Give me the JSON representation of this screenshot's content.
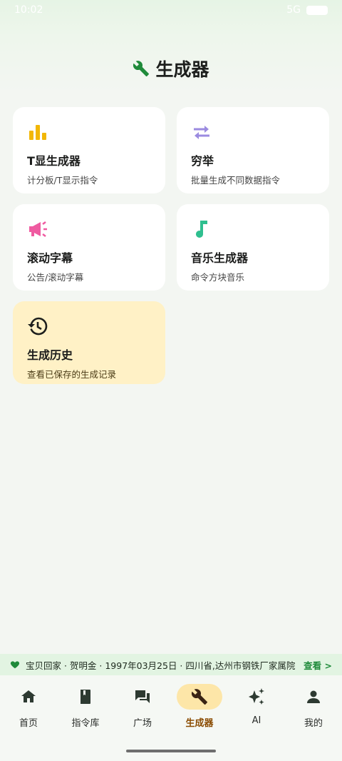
{
  "status": {
    "time": "10:02",
    "signal": "5G"
  },
  "header": {
    "title": "生成器"
  },
  "cards": [
    {
      "title": "T显生成器",
      "subtitle": "计分板/T显示指令",
      "icon": "bar-chart-icon",
      "color": "#f2b705"
    },
    {
      "title": "穷举",
      "subtitle": "批量生成不同数据指令",
      "icon": "swap-arrows-icon",
      "color": "#9b8be0"
    },
    {
      "title": "滚动字幕",
      "subtitle": "公告/滚动字幕",
      "icon": "megaphone-icon",
      "color": "#ef5ba1"
    },
    {
      "title": "音乐生成器",
      "subtitle": "命令方块音乐",
      "icon": "music-note-icon",
      "color": "#2fbf8f"
    },
    {
      "title": "生成历史",
      "subtitle": "查看已保存的生成记录",
      "icon": "history-icon",
      "color": "#1d1f1d"
    }
  ],
  "ticker": {
    "message": "宝贝回家 · 贺明金 · 1997年03月25日 · 四川省,达州市钢铁厂家属院",
    "action": "查看 >"
  },
  "nav": {
    "items": [
      {
        "label": "首页",
        "icon": "home-icon"
      },
      {
        "label": "指令库",
        "icon": "book-icon"
      },
      {
        "label": "广场",
        "icon": "forum-icon"
      },
      {
        "label": "生成器",
        "icon": "wrench-icon",
        "active": true
      },
      {
        "label": "AI",
        "icon": "sparkle-icon"
      },
      {
        "label": "我的",
        "icon": "person-icon"
      }
    ]
  },
  "colors": {
    "accent": "#1f8a3a",
    "active_nav_bg": "#fde6a8",
    "history_card_bg": "#fff1c6"
  }
}
